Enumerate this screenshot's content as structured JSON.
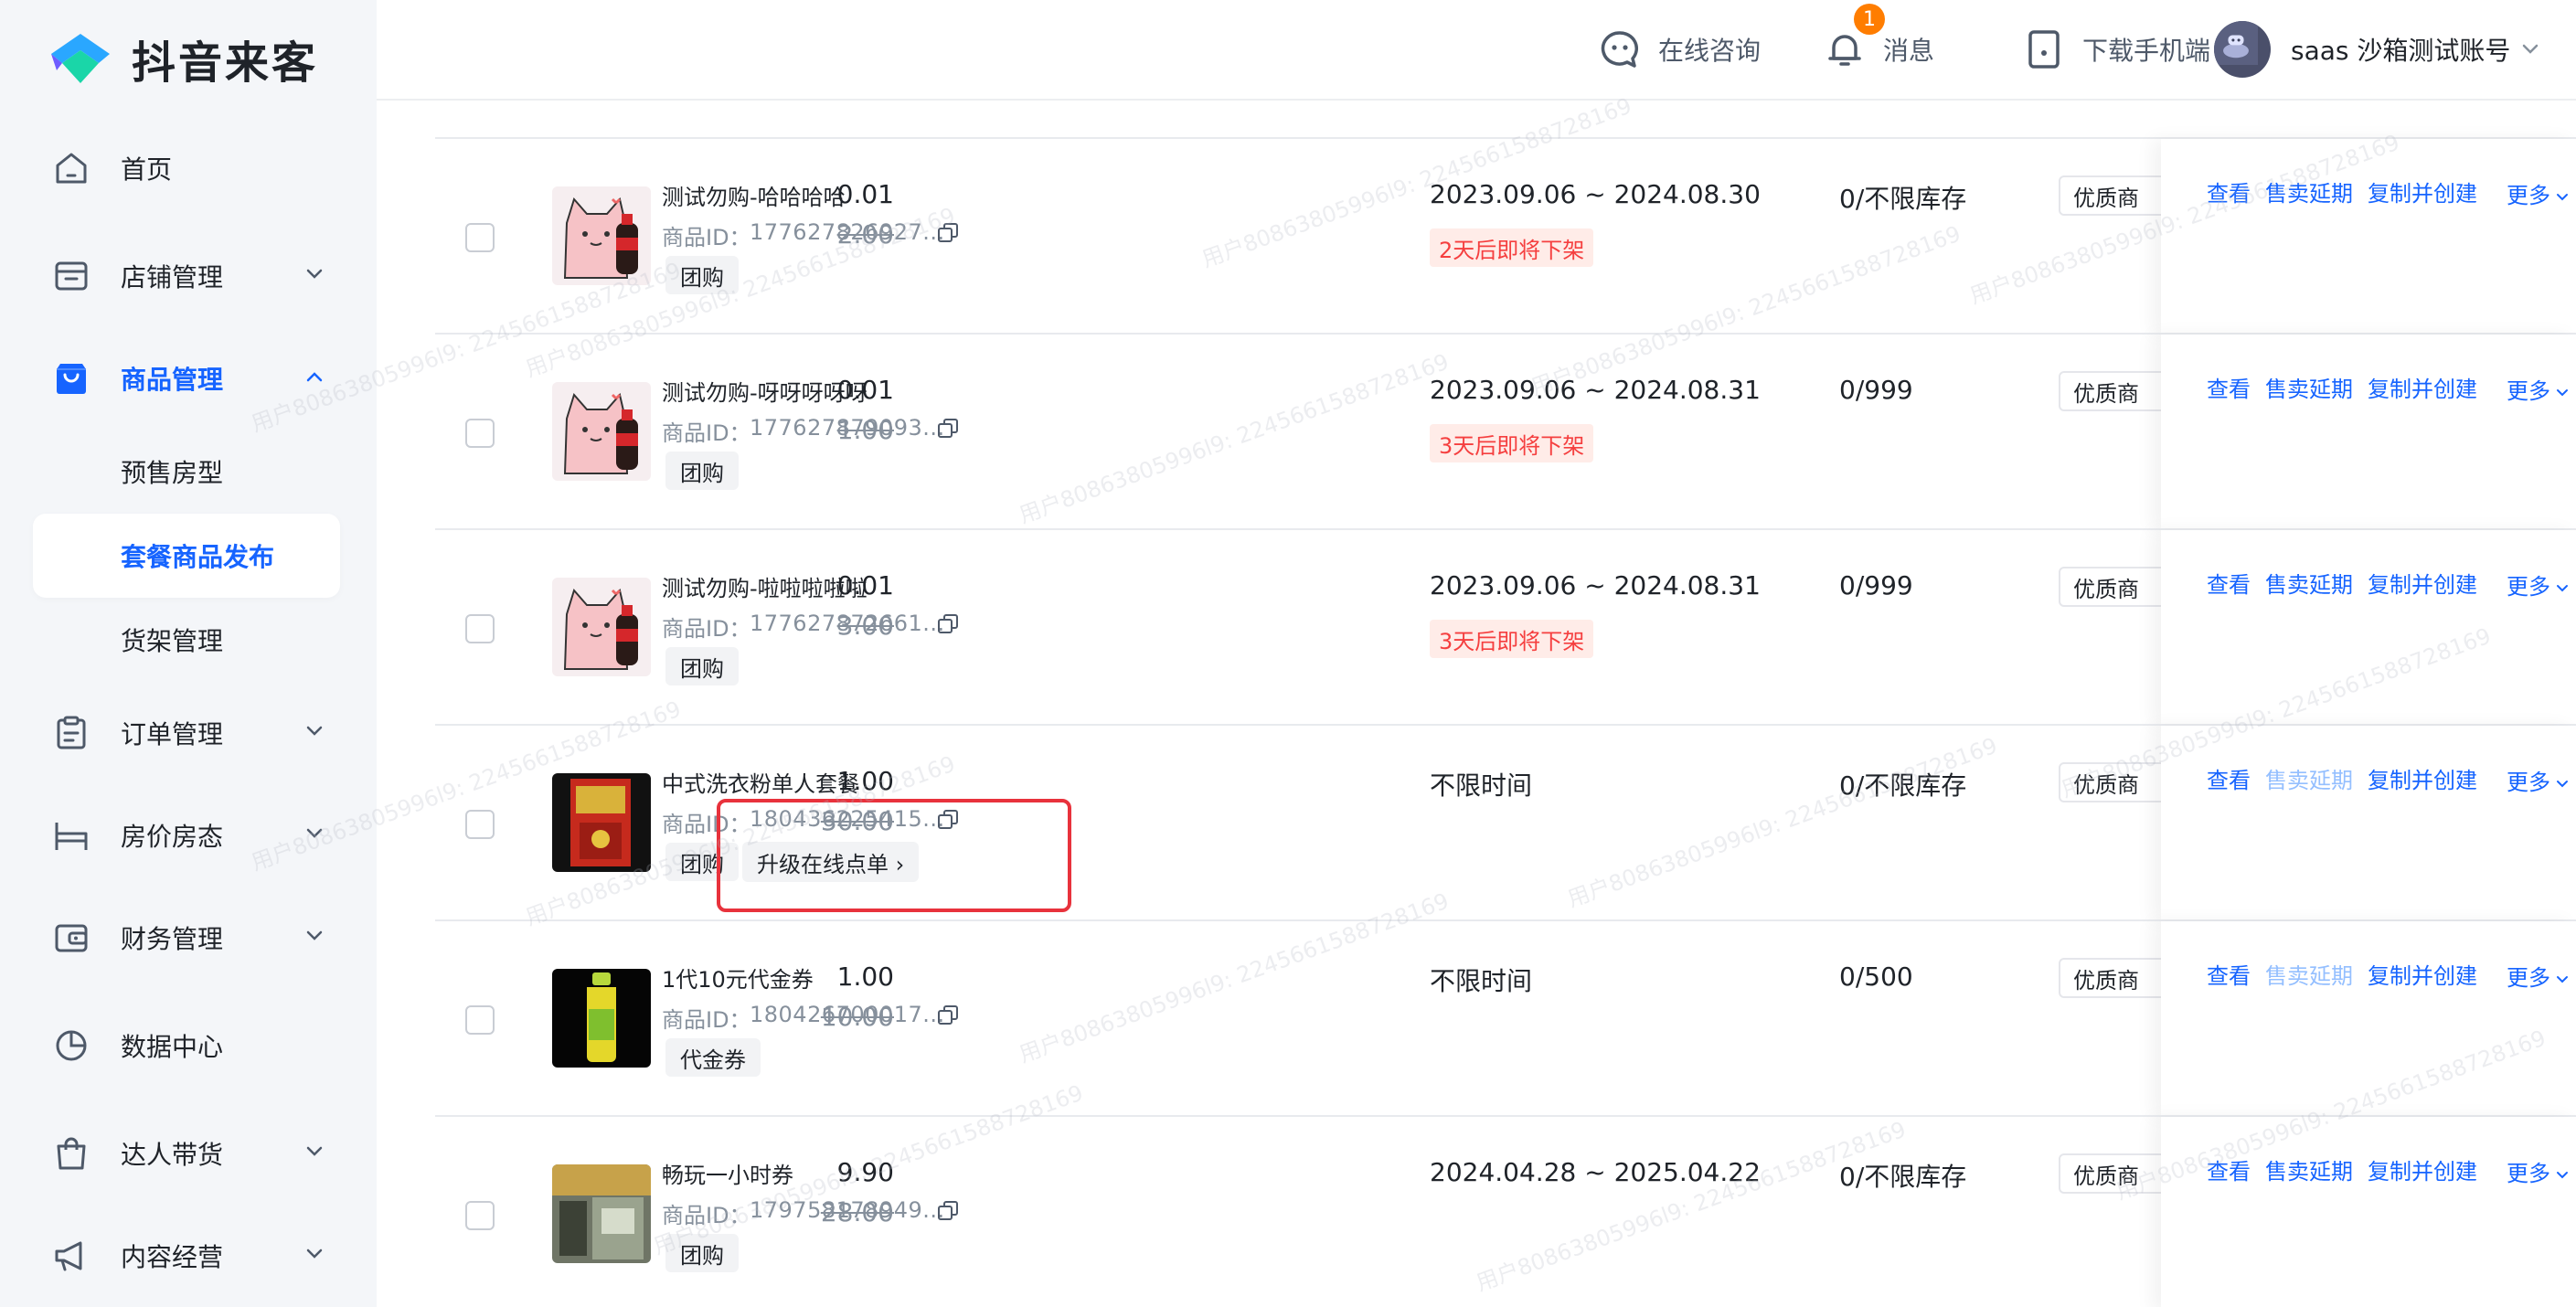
{
  "app": {
    "logo_text": "抖音来客"
  },
  "header": {
    "consult_label": "在线咨询",
    "message_label": "消息",
    "message_badge": "1",
    "download_label": "下载手机端",
    "account_label": "saas 沙箱测试账号"
  },
  "sidebar": {
    "items": [
      {
        "label": "首页"
      },
      {
        "label": "店铺管理"
      },
      {
        "label": "商品管理"
      },
      {
        "label": "订单管理"
      },
      {
        "label": "房价房态"
      },
      {
        "label": "财务管理"
      },
      {
        "label": "数据中心"
      },
      {
        "label": "达人带货"
      },
      {
        "label": "内容经营"
      }
    ],
    "subitems": [
      {
        "label": "预售房型"
      },
      {
        "label": "套餐商品发布"
      },
      {
        "label": "货架管理"
      }
    ]
  },
  "table": {
    "id_label": "商品ID：",
    "quality_tag": "优质商",
    "actions": {
      "view": "查看",
      "extend": "售卖延期",
      "copy": "复制并创建",
      "more": "更多"
    },
    "rows": [
      {
        "name": "测试勿购-哈哈哈哈",
        "id": "177627826927...",
        "tag": "团购",
        "price": "0.01",
        "original_price": "2.00",
        "period": "2023.09.06 ~ 2024.08.30",
        "expire": "2天后即将下架",
        "stock": "0/不限库存",
        "extend_disabled": false
      },
      {
        "name": "测试勿购-呀呀呀呀呀",
        "id": "177627879093...",
        "tag": "团购",
        "price": "0.01",
        "original_price": "1.00",
        "period": "2023.09.06 ~ 2024.08.31",
        "expire": "3天后即将下架",
        "stock": "0/999",
        "extend_disabled": false
      },
      {
        "name": "测试勿购-啦啦啦啦啦",
        "id": "177627872661...",
        "tag": "团购",
        "price": "0.01",
        "original_price": "3.00",
        "period": "2023.09.06 ~ 2024.08.31",
        "expire": "3天后即将下架",
        "stock": "0/999",
        "extend_disabled": false
      },
      {
        "name": "中式洗衣粉单人套餐",
        "id": "180436225415...",
        "tag": "团购",
        "price": "1.00",
        "original_price": "30.00",
        "period": "不限时间",
        "expire": "",
        "stock": "0/不限库存",
        "extend_disabled": true
      },
      {
        "name": "1代10元代金券",
        "id": "180426700017...",
        "tag": "代金券",
        "price": "1.00",
        "original_price": "10.00",
        "period": "不限时间",
        "expire": "",
        "stock": "0/500",
        "extend_disabled": true
      },
      {
        "name": "畅玩一小时券",
        "id": "179758178949...",
        "tag": "团购",
        "price": "9.90",
        "original_price": "28.00",
        "period": "2024.04.28 ~ 2025.04.22",
        "expire": "",
        "stock": "0/不限库存",
        "extend_disabled": false
      }
    ],
    "upgrade_label": "升级在线点单 ›"
  },
  "watermark_text": "用户80863805996l9: 2245661588728169",
  "colors": {
    "accent": "#1664ff",
    "sidebar_bg": "#f4f6f9",
    "expire_red": "#f53f3f",
    "highlight_red": "#e8323c"
  }
}
